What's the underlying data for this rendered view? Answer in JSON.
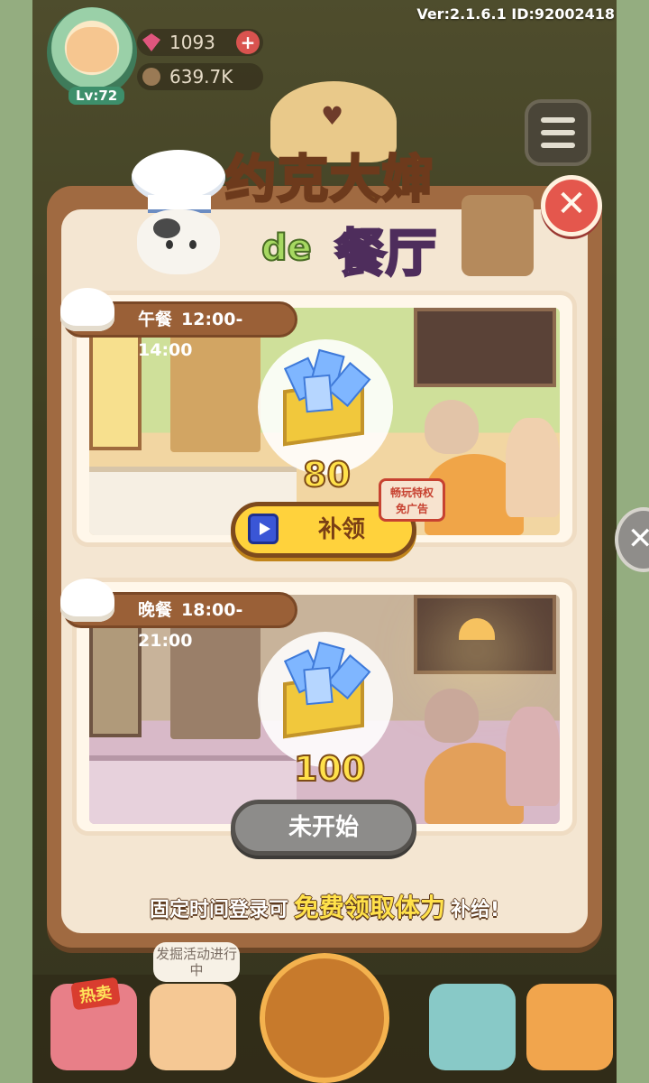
{
  "hud": {
    "version": "Ver:2.1.6.1 ID:92002418",
    "level": "Lv:72",
    "gems": "1093",
    "seeds": "639.7K",
    "plus_label": "+"
  },
  "popup": {
    "title_line1": "约克大婶",
    "title_de": "de",
    "title_line2": "餐厅",
    "close_glyph": "✕",
    "lunch": {
      "meal": "午餐",
      "time": "12:00-14:00",
      "reward_amount": "80",
      "button_label": "补领",
      "ad_tag_line1": "畅玩特权",
      "ad_tag_line2": "免广告"
    },
    "dinner": {
      "meal": "晚餐",
      "time": "18:00-21:00",
      "reward_amount": "100",
      "button_label": "未开始"
    },
    "footer_before": "固定时间登录可",
    "footer_highlight": "免费领取体力",
    "footer_after": "补给!"
  },
  "bottom_bar": {
    "hot_badge": "热卖",
    "event_bubble": "发掘活动进行中"
  },
  "side_close_glyph": "✕",
  "colors": {
    "claim_button": "#ffd23c",
    "disabled_button": "#8d8c8a",
    "close_button": "#e4574d",
    "highlight_text": "#ffe14a"
  },
  "icons": [
    "gem-icon",
    "seed-icon",
    "menu-icon",
    "close-icon",
    "chef-hat-icon",
    "crystal-crate-icon",
    "video-ad-icon"
  ]
}
